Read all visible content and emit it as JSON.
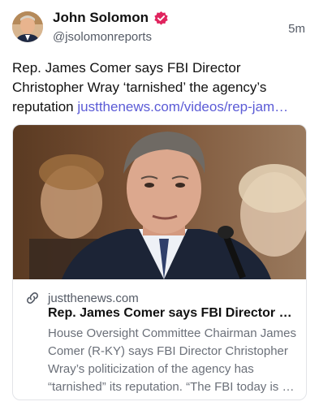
{
  "post": {
    "author_name": "John Solomon",
    "handle": "@jsolomonreports",
    "time": "5m",
    "text": "Rep. James Comer says FBI Director Christopher Wray ‘tarnished’ the agency’s reputation",
    "link_text": "justthenews.com/videos/rep-jam…"
  },
  "link_card": {
    "domain": "justthenews.com",
    "title": "Rep. James Comer says FBI Director …",
    "description": "House Oversight Committee Chairman James Comer (R-KY) says FBI Director Christopher Wray’s politicization of the agency has “tarnished” its reputation. “The FBI today is …"
  },
  "colors": {
    "link": "#5b5bd6",
    "verified_badge": "#e0245e",
    "secondary_text": "#555b66"
  },
  "icons": {
    "verified": "verified-badge-icon",
    "link": "link-icon"
  }
}
